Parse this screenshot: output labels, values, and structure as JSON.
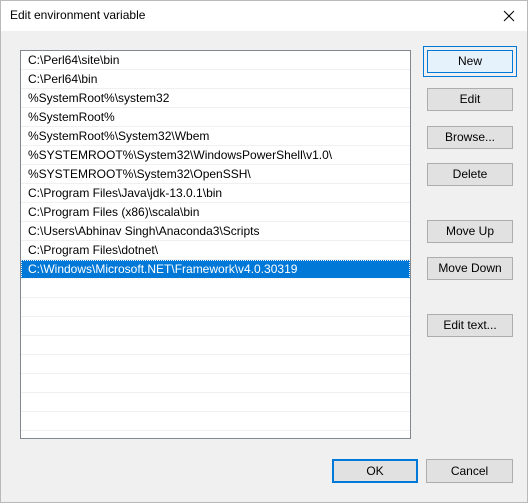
{
  "window": {
    "title": "Edit environment variable"
  },
  "icons": {
    "close": "close-icon"
  },
  "paths": [
    "C:\\Perl64\\site\\bin",
    "C:\\Perl64\\bin",
    "%SystemRoot%\\system32",
    "%SystemRoot%",
    "%SystemRoot%\\System32\\Wbem",
    "%SYSTEMROOT%\\System32\\WindowsPowerShell\\v1.0\\",
    "%SYSTEMROOT%\\System32\\OpenSSH\\",
    "C:\\Program Files\\Java\\jdk-13.0.1\\bin",
    "C:\\Program Files (x86)\\scala\\bin",
    "C:\\Users\\Abhinav Singh\\Anaconda3\\Scripts",
    "C:\\Program Files\\dotnet\\",
    "C:\\Windows\\Microsoft.NET\\Framework\\v4.0.30319"
  ],
  "selected_index": 11,
  "buttons": {
    "new": "New",
    "edit": "Edit",
    "browse": "Browse...",
    "delete": "Delete",
    "move_up": "Move Up",
    "move_down": "Move Down",
    "edit_text": "Edit text...",
    "ok": "OK",
    "cancel": "Cancel"
  },
  "colors": {
    "selection": "#0078d7",
    "focus_border": "#0078d7"
  }
}
